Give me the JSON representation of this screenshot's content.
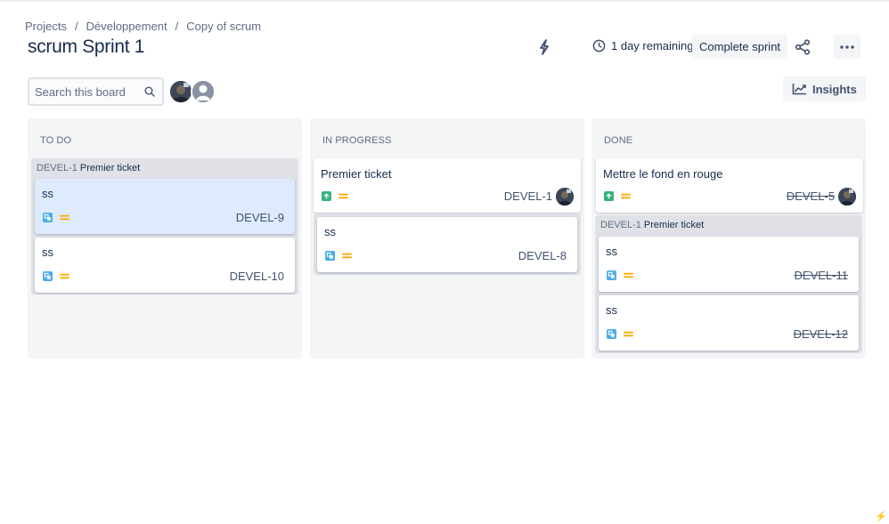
{
  "breadcrumb": {
    "items": [
      "Projects",
      "Développement",
      "Copy of scrum"
    ],
    "separator": "/"
  },
  "header": {
    "title": "scrum Sprint 1",
    "remaining": "1 day remaining",
    "complete_label": "Complete sprint"
  },
  "toolbar": {
    "search_placeholder": "Search this board",
    "insights_label": "Insights"
  },
  "colors": {
    "story": "#36b37e",
    "subtask": "#4bade8",
    "priority_medium": "#ffab00",
    "column_bg": "#f4f5f7",
    "selected_card": "#deebff"
  },
  "columns": [
    {
      "title": "TO DO",
      "group": {
        "key": "DEVEL-1",
        "title": "Premier ticket"
      },
      "cards": [
        {
          "summary": "ss",
          "key": "DEVEL-9",
          "type": "subtask-icon",
          "priority": "medium-priority-icon"
        },
        {
          "summary": "ss",
          "key": "DEVEL-10",
          "type": "subtask-icon",
          "priority": "medium-priority-icon"
        }
      ]
    },
    {
      "title": "IN PROGRESS",
      "cards": [
        {
          "summary": "Premier ticket",
          "key": "DEVEL-1",
          "type": "story-icon",
          "priority": "medium-priority-icon"
        },
        {
          "summary": "ss",
          "key": "DEVEL-8",
          "type": "subtask-icon",
          "priority": "medium-priority-icon"
        }
      ]
    },
    {
      "title": "DONE",
      "cards": [
        {
          "summary": "Mettre le fond en rouge",
          "key": "DEVEL-5",
          "type": "story-icon",
          "priority": "medium-priority-icon"
        }
      ],
      "group": {
        "key": "DEVEL-1",
        "title": "Premier ticket"
      },
      "group_cards": [
        {
          "summary": "ss",
          "key": "DEVEL-11",
          "type": "subtask-icon",
          "priority": "medium-priority-icon"
        },
        {
          "summary": "ss",
          "key": "DEVEL-12",
          "type": "subtask-icon",
          "priority": "medium-priority-icon"
        }
      ]
    }
  ]
}
